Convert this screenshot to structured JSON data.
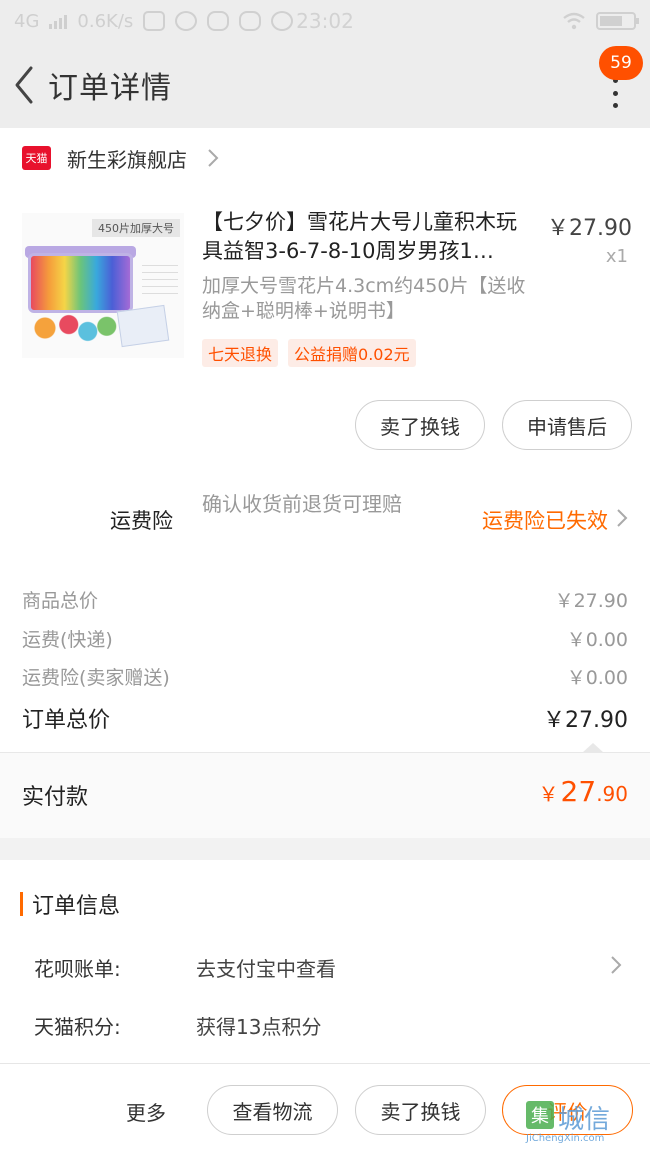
{
  "status_bar": {
    "network": "4G",
    "speed": "0.6K/s",
    "time": "23:02"
  },
  "nav": {
    "title": "订单详情",
    "badge_count": "59"
  },
  "store": {
    "logo_text": "天猫",
    "name": "新生彩旗舰店"
  },
  "product": {
    "image_caption": "450片加厚大号",
    "title": "【七夕价】雪花片大号儿童积木玩具益智3-6-7-8-10周岁男孩1…",
    "price": "￥27.90",
    "qty": "x1",
    "spec": "加厚大号雪花片4.3cm约450片【送收纳盒+聪明棒+说明书】",
    "tags": [
      "七天退换",
      "公益捐赠0.02元"
    ]
  },
  "product_actions": {
    "sell_label": "卖了换钱",
    "after_sale_label": "申请售后"
  },
  "insurance": {
    "label": "运费险",
    "desc": "确认收货前退货可理赔",
    "status": "运费险已失效"
  },
  "costs": {
    "rows": [
      {
        "label": "商品总价",
        "value": "￥27.90"
      },
      {
        "label": "运费(快递)",
        "value": "￥0.00"
      },
      {
        "label": "运费险(卖家赠送)",
        "value": "￥0.00"
      }
    ],
    "total_label": "订单总价",
    "total_value": "￥27.90"
  },
  "paid": {
    "label": "实付款",
    "currency": "￥",
    "int": "27",
    "dec": ".90"
  },
  "order_info": {
    "heading": "订单信息",
    "rows": [
      {
        "label": "花呗账单:",
        "value": "去支付宝中查看"
      },
      {
        "label": "天猫积分:",
        "value": "获得13点积分"
      }
    ]
  },
  "bottom_bar": {
    "more_label": "更多",
    "logistics_label": "查看物流",
    "sell_label": "卖了换钱",
    "review_label": "评价"
  },
  "watermark": {
    "mark": "集",
    "text": "城信",
    "sub": "JiChengXin.com"
  },
  "colors": {
    "accent": "#ff5000",
    "tmall_red": "#e8112d"
  }
}
